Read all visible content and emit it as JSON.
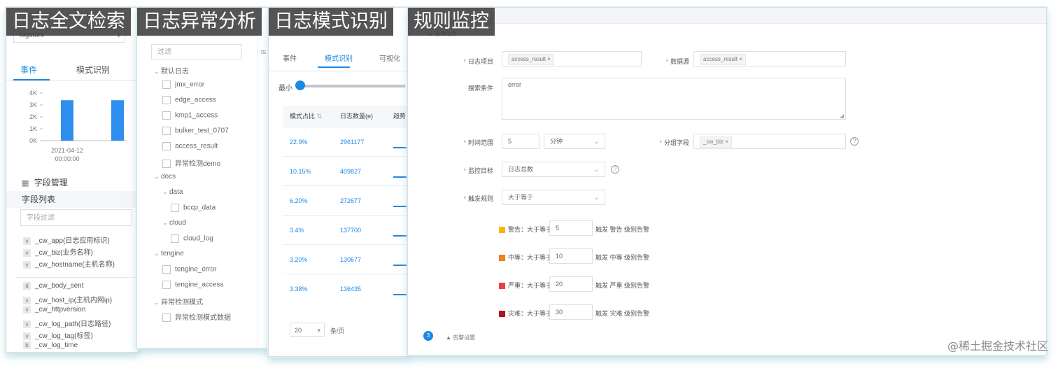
{
  "captions": {
    "p1": "日志全文检索",
    "p2": "日志异常分析",
    "p3": "日志模式识别",
    "p4": "规则监控"
  },
  "panel1": {
    "logstore_select": "logstore",
    "tabs": [
      "事件",
      "模式识别"
    ],
    "field_management": "字段管理",
    "field_list": "字段列表",
    "field_filter_placeholder": "字段过滤",
    "fields_top": [
      {
        "type": "v",
        "name": "_cw_app(日志应用标识)"
      },
      {
        "type": "v",
        "name": "_cw_biz(业务名称)"
      },
      {
        "type": "v",
        "name": "_cw_hostname(主机名称)"
      }
    ],
    "fields_bottom": [
      {
        "type": "d",
        "name": "_cw_body_sent"
      },
      {
        "type": "v",
        "name": "_cw_host_ip(主机内网ip)"
      },
      {
        "type": "v",
        "name": "_cw_httpversion"
      },
      {
        "type": "v",
        "name": "_cw_log_path(日志路径)"
      },
      {
        "type": "v",
        "name": "_cw_log_tag(标签)"
      },
      {
        "type": "b",
        "name": "_cw_log_time"
      }
    ]
  },
  "chart_data": {
    "type": "bar",
    "categories": [
      "2021-04-12 00:00:00",
      ""
    ],
    "values": [
      3400,
      3400
    ],
    "y_ticks": [
      "4K",
      "3K",
      "2K",
      "1K",
      "0K"
    ],
    "x_tick_date": "2021-04-12",
    "x_tick_time": "00:00:00",
    "ylim": [
      0,
      4000
    ],
    "bar_color": "#2f8ff0"
  },
  "panel2": {
    "filter_placeholder": "过滤",
    "tree": [
      {
        "level": 0,
        "kind": "group",
        "label": "默认日志"
      },
      {
        "level": 1,
        "kind": "leaf",
        "label": "jmx_error"
      },
      {
        "level": 1,
        "kind": "leaf",
        "label": "edge_access"
      },
      {
        "level": 1,
        "kind": "leaf",
        "label": "kmp1_access"
      },
      {
        "level": 1,
        "kind": "leaf",
        "label": "bulker_test_0707"
      },
      {
        "level": 1,
        "kind": "leaf",
        "label": "access_result"
      },
      {
        "level": 1,
        "kind": "leaf",
        "label": "异常检测demo"
      },
      {
        "level": 0,
        "kind": "group",
        "label": "docs"
      },
      {
        "level": 1,
        "kind": "group",
        "label": "data"
      },
      {
        "level": 2,
        "kind": "leaf",
        "label": "bccp_data"
      },
      {
        "level": 1,
        "kind": "group",
        "label": "cloud"
      },
      {
        "level": 2,
        "kind": "leaf",
        "label": "cloud_log"
      },
      {
        "level": 0,
        "kind": "group",
        "label": "tengine"
      },
      {
        "level": 1,
        "kind": "leaf",
        "label": "tengine_error"
      },
      {
        "level": 1,
        "kind": "leaf",
        "label": "tengine_access"
      },
      {
        "level": 0,
        "kind": "group",
        "label": "异常检测模式"
      },
      {
        "level": 1,
        "kind": "leaf",
        "label": "异常检测模式数据"
      }
    ]
  },
  "panel3": {
    "tabs": [
      "事件",
      "模式识别",
      "可视化"
    ],
    "slider_label": "最小",
    "col_pct": "模式占比",
    "col_count": "日志数量(e)",
    "col_trend": "趋势",
    "rows": [
      {
        "pct": "22.9%",
        "count": "2961177"
      },
      {
        "pct": "10.15%",
        "count": "409827"
      },
      {
        "pct": "6.20%",
        "count": "272677"
      },
      {
        "pct": "3.4%",
        "count": "137700"
      },
      {
        "pct": "3.20%",
        "count": "130677"
      },
      {
        "pct": "3.38%",
        "count": "136435"
      }
    ],
    "page_size": "20",
    "page_suffix": "条/页"
  },
  "panel4": {
    "log_project_label": "日志项目",
    "log_project_tag": "access_result",
    "data_source_label": "数据源",
    "data_source_tag": "access_result",
    "query_label": "搜索条件",
    "query_value": "error",
    "time_range_label": "时间范围",
    "time_range_value": "5",
    "time_unit": "分钟",
    "group_by_label": "分组字段",
    "group_by_tag": "_cw_biz",
    "monitor_label": "监控目标",
    "monitor_value": "日志总数",
    "trigger_label": "触发规则",
    "trigger_value": "大于等于",
    "levels": [
      {
        "name": "警告",
        "cond": "大于等于",
        "value": "5",
        "action": "触发 警告 级别告警",
        "color": "#f5b800"
      },
      {
        "name": "中等",
        "cond": "大于等于",
        "value": "10",
        "action": "触发 中等 级别告警",
        "color": "#f0821e"
      },
      {
        "name": "严重",
        "cond": "大于等于",
        "value": "20",
        "action": "触发 严重 级别告警",
        "color": "#e8413c"
      },
      {
        "name": "灾难",
        "cond": "大于等于",
        "value": "30",
        "action": "触发 灾难 级别告警",
        "color": "#b2161d"
      }
    ],
    "step_top_label": "基本信息",
    "step_bottom_num": "3",
    "step_bottom_label": "告警设置"
  },
  "watermark": "@稀土掘金技术社区"
}
